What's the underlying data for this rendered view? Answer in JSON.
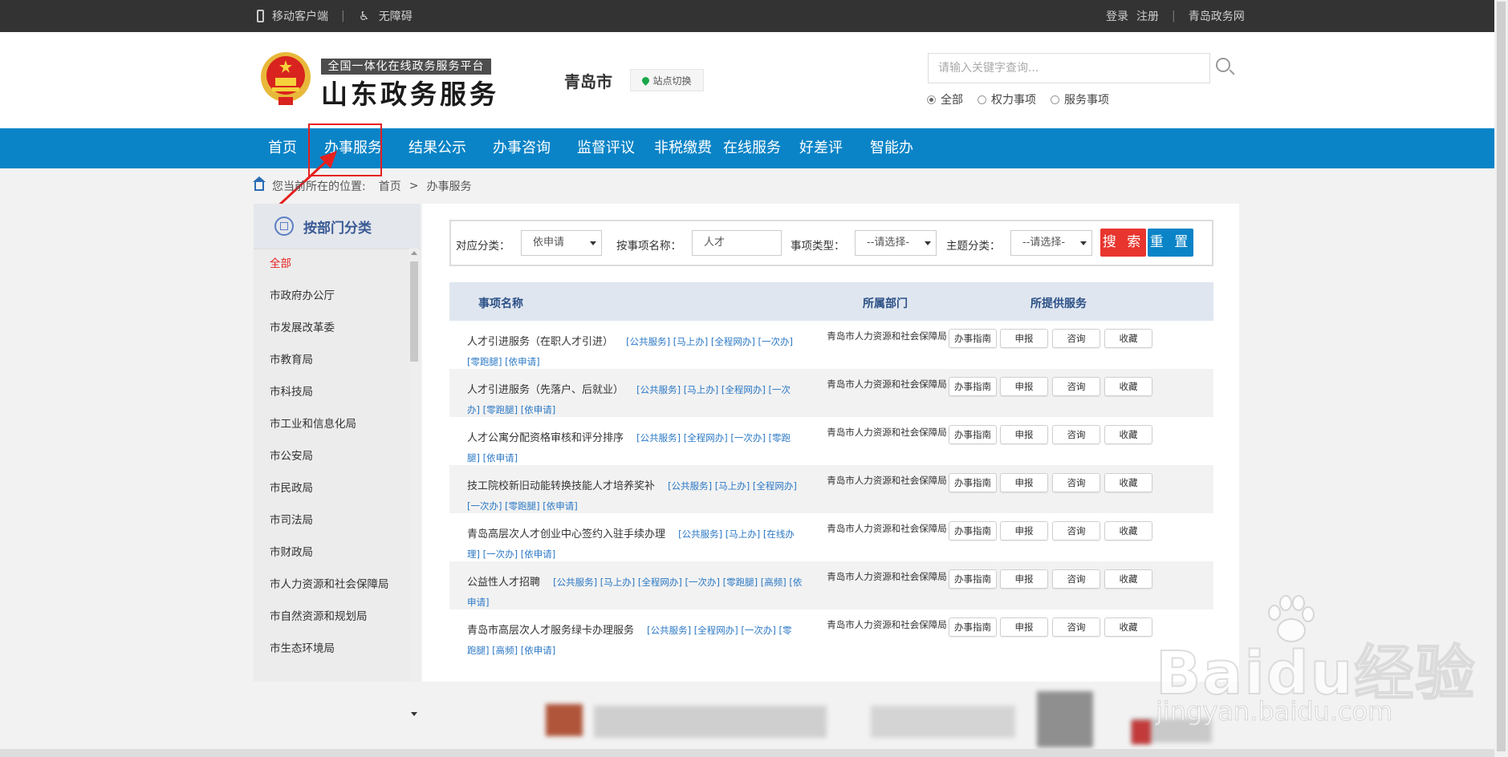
{
  "topbar": {
    "mobile_label": "移动客户端",
    "accessible_label": "无障碍",
    "login": "登录",
    "register": "注册",
    "site_link": "青岛政务网"
  },
  "header": {
    "platform_tagline": "全国一体化在线政务服务平台",
    "brand": "山东政务服务",
    "city": "青岛市",
    "site_switch": "站点切换",
    "search_placeholder": "请输入关键字查询...",
    "scope_options": [
      "全部",
      "权力事项",
      "服务事项"
    ],
    "scope_selected": "全部"
  },
  "nav": {
    "items": [
      "首页",
      "办事服务",
      "结果公示",
      "办事咨询",
      "监督评议",
      "非税缴费",
      "在线服务",
      "好差评",
      "智能办"
    ],
    "highlighted": "办事服务"
  },
  "breadcrumb": {
    "prefix": "您当前所在的位置:",
    "home": "首页",
    "separator": ">",
    "current": "办事服务"
  },
  "sidebar": {
    "title": "按部门分类",
    "items": [
      "全部",
      "市政府办公厅",
      "市发展改革委",
      "市教育局",
      "市科技局",
      "市工业和信息化局",
      "市公安局",
      "市民政局",
      "市司法局",
      "市财政局",
      "市人力资源和社会保障局",
      "市自然资源和规划局",
      "市生态环境局"
    ],
    "active": "全部"
  },
  "filter": {
    "category_label": "对应分类：",
    "category_value": "依申请",
    "name_label": "按事项名称：",
    "name_value": "人才",
    "type_label": "事项类型：",
    "type_value": "--请选择-",
    "topic_label": "主题分类：",
    "topic_value": "--请选择-",
    "search_btn": "搜 索",
    "reset_btn": "重 置"
  },
  "table": {
    "headers": [
      "事项名称",
      "所属部门",
      "所提供服务"
    ],
    "actions": [
      "办事指南",
      "申报",
      "咨询",
      "收藏"
    ],
    "rows": [
      {
        "name": "人才引进服务（在职人才引进）",
        "line1_tags": "[公共服务] [马上办] [全程网办] [一次办]",
        "line2": "[零跑腿] [依申请]",
        "dept": "青岛市人力资源和社会保障局"
      },
      {
        "name": "人才引进服务（先落户、后就业）",
        "line1_tags": "[公共服务] [马上办] [全程网办] [一次",
        "line2": "办] [零跑腿] [依申请]",
        "dept": "青岛市人力资源和社会保障局"
      },
      {
        "name": "人才公寓分配资格审核和评分排序",
        "line1_tags": "[公共服务] [全程网办] [一次办] [零跑",
        "line2": "腿] [依申请]",
        "dept": "青岛市人力资源和社会保障局"
      },
      {
        "name": "技工院校新旧动能转换技能人才培养奖补",
        "line1_tags": "[公共服务] [马上办] [全程网办]",
        "line2": "[一次办] [零跑腿] [依申请]",
        "dept": "青岛市人力资源和社会保障局"
      },
      {
        "name": "青岛高层次人才创业中心签约入驻手续办理",
        "line1_tags": "[公共服务] [马上办] [在线办",
        "line2": "理] [一次办] [依申请]",
        "dept": "青岛市人力资源和社会保障局"
      },
      {
        "name": "公益性人才招聘",
        "line1_tags": "[公共服务] [马上办] [全程网办] [一次办] [零跑腿] [高频] [依",
        "line2": "申请]",
        "dept": "青岛市人力资源和社会保障局"
      },
      {
        "name": "青岛市高层次人才服务绿卡办理服务",
        "line1_tags": "[公共服务] [全程网办] [一次办] [零",
        "line2": "跑腿] [高频] [依申请]",
        "dept": "青岛市人力资源和社会保障局"
      }
    ]
  },
  "watermark": {
    "main": "Baidu经验",
    "sub": "jingyan.baidu.com"
  },
  "colors": {
    "nav_blue": "#0a84c7",
    "highlight_red": "#e5201f",
    "search_red": "#e8352e",
    "tag_blue": "#2b78c5"
  }
}
